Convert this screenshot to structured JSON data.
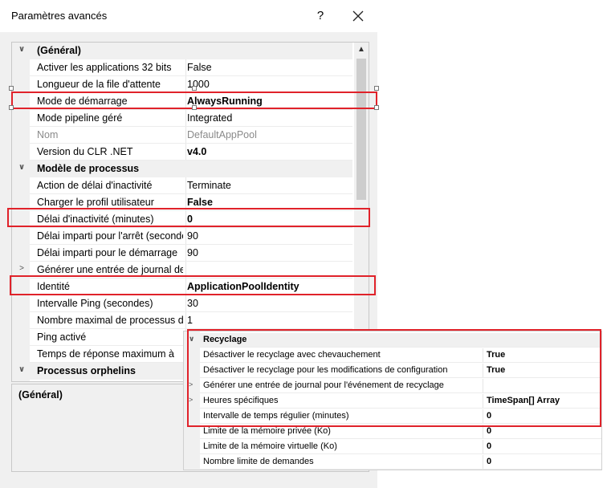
{
  "dialog": {
    "title": "Paramètres avancés",
    "help_label": "?",
    "close_label": "✕"
  },
  "grid": {
    "rows": [
      {
        "name": "(Général)",
        "value": "",
        "kind": "category",
        "expander": "∨"
      },
      {
        "name": "Activer les applications 32 bits",
        "value": "False"
      },
      {
        "name": "Longueur de la file d'attente",
        "value": "1000"
      },
      {
        "name": "Mode de démarrage",
        "value": "AlwaysRunning",
        "bold": true
      },
      {
        "name": "Mode pipeline géré",
        "value": "Integrated"
      },
      {
        "name": "Nom",
        "value": "DefaultAppPool",
        "disabled": true
      },
      {
        "name": "Version du CLR .NET",
        "value": "v4.0",
        "bold": true
      },
      {
        "name": "Modèle de processus",
        "value": "",
        "kind": "category",
        "expander": "∨"
      },
      {
        "name": "Action de délai d'inactivité",
        "value": "Terminate"
      },
      {
        "name": "Charger le profil utilisateur",
        "value": "False",
        "bold": true
      },
      {
        "name": "Délai d'inactivité (minutes)",
        "value": "0",
        "bold": true
      },
      {
        "name": "Délai imparti pour l'arrêt (secondes)",
        "value": "90"
      },
      {
        "name": "Délai imparti pour le démarrage",
        "value": "90"
      },
      {
        "name": "Générer une entrée de journal de",
        "value": "",
        "expander": ">"
      },
      {
        "name": "Identité",
        "value": "ApplicationPoolIdentity",
        "bold": true
      },
      {
        "name": "Intervalle Ping (secondes)",
        "value": "30"
      },
      {
        "name": "Nombre maximal de processus de",
        "value": "1"
      },
      {
        "name": "Ping activé",
        "value": ""
      },
      {
        "name": "Temps de réponse maximum à",
        "value": ""
      },
      {
        "name": "Processus orphelins",
        "value": "",
        "kind": "category",
        "expander": "∨"
      }
    ],
    "scroll_up": "▲"
  },
  "description": {
    "title": "(Général)"
  },
  "overlay": {
    "rows": [
      {
        "name": "Recyclage",
        "value": "",
        "kind": "category",
        "expander": "∨"
      },
      {
        "name": "Désactiver le recyclage avec chevauchement",
        "value": "True"
      },
      {
        "name": "Désactiver le recyclage pour les modifications de configuration",
        "value": "True"
      },
      {
        "name": "Générer une entrée de journal pour l'événement de recyclage",
        "value": "",
        "expander": ">"
      },
      {
        "name": "Heures spécifiques",
        "value": "TimeSpan[] Array",
        "expander": ">"
      },
      {
        "name": "Intervalle de temps régulier (minutes)",
        "value": "0"
      },
      {
        "name": "Limite de la mémoire privée (Ko)",
        "value": "0"
      },
      {
        "name": "Limite de la mémoire virtuelle (Ko)",
        "value": "0"
      },
      {
        "name": "Nombre limite de demandes",
        "value": "0"
      }
    ]
  },
  "colors": {
    "highlight": "#e0222a"
  }
}
